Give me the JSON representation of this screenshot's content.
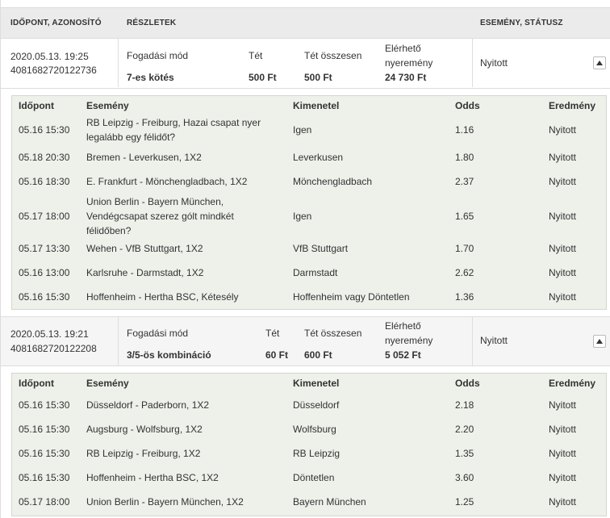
{
  "header": {
    "col_time_id": "IDŐPONT, AZONOSÍTÓ",
    "col_details": "RÉSZLETEK",
    "col_event_status": "ESEMÉNY, STÁTUSZ"
  },
  "bets": [
    {
      "datetime": "2020.05.13. 19:25",
      "id": "4081682720122736",
      "mode_label": "Fogadási mód",
      "mode_value": "7-es kötés",
      "stake_label": "Tét",
      "stake_value": "500 Ft",
      "total_label": "Tét összesen",
      "total_value": "500 Ft",
      "win_label_1": "Elérhető",
      "win_label_2": "nyeremény",
      "win_value": "24 730 Ft",
      "status": "Nyitott",
      "detail_headers": {
        "time": "Időpont",
        "event": "Esemény",
        "outcome": "Kimenetel",
        "odds": "Odds",
        "result": "Eredmény"
      },
      "rows": [
        {
          "time": "05.16 15:30",
          "event": "RB Leipzig - Freiburg, Hazai csapat nyer legalább egy félidőt?",
          "outcome": "Igen",
          "odds": "1.16",
          "result": "Nyitott"
        },
        {
          "time": "05.18 20:30",
          "event": "Bremen - Leverkusen, 1X2",
          "outcome": "Leverkusen",
          "odds": "1.80",
          "result": "Nyitott"
        },
        {
          "time": "05.16 18:30",
          "event": "E. Frankfurt - Mönchengladbach, 1X2",
          "outcome": "Mönchengladbach",
          "odds": "2.37",
          "result": "Nyitott"
        },
        {
          "time": "05.17 18:00",
          "event": "Union Berlin - Bayern München, Vendégcsapat szerez gólt mindkét félidőben?",
          "outcome": "Igen",
          "odds": "1.65",
          "result": "Nyitott"
        },
        {
          "time": "05.17 13:30",
          "event": "Wehen - VfB Stuttgart, 1X2",
          "outcome": "VfB Stuttgart",
          "odds": "1.70",
          "result": "Nyitott"
        },
        {
          "time": "05.16 13:00",
          "event": "Karlsruhe - Darmstadt, 1X2",
          "outcome": "Darmstadt",
          "odds": "2.62",
          "result": "Nyitott"
        },
        {
          "time": "05.16 15:30",
          "event": "Hoffenheim - Hertha BSC, Kétesély",
          "outcome": "Hoffenheim vagy Döntetlen",
          "odds": "1.36",
          "result": "Nyitott"
        }
      ]
    },
    {
      "datetime": "2020.05.13. 19:21",
      "id": "4081682720122208",
      "mode_label": "Fogadási mód",
      "mode_value": "3/5-ös kombináció",
      "stake_label": "Tét",
      "stake_value": "60 Ft",
      "total_label": "Tét összesen",
      "total_value": "600 Ft",
      "win_label_1": "Elérhető",
      "win_label_2": "nyeremény",
      "win_value": "5 052 Ft",
      "status": "Nyitott",
      "detail_headers": {
        "time": "Időpont",
        "event": "Esemény",
        "outcome": "Kimenetel",
        "odds": "Odds",
        "result": "Eredmény"
      },
      "rows": [
        {
          "time": "05.16 15:30",
          "event": "Düsseldorf - Paderborn, 1X2",
          "outcome": "Düsseldorf",
          "odds": "2.18",
          "result": "Nyitott"
        },
        {
          "time": "05.16 15:30",
          "event": "Augsburg - Wolfsburg, 1X2",
          "outcome": "Wolfsburg",
          "odds": "2.20",
          "result": "Nyitott"
        },
        {
          "time": "05.16 15:30",
          "event": "RB Leipzig - Freiburg, 1X2",
          "outcome": "RB Leipzig",
          "odds": "1.35",
          "result": "Nyitott"
        },
        {
          "time": "05.16 15:30",
          "event": "Hoffenheim - Hertha BSC, 1X2",
          "outcome": "Döntetlen",
          "odds": "3.60",
          "result": "Nyitott"
        },
        {
          "time": "05.17 18:00",
          "event": "Union Berlin - Bayern München, 1X2",
          "outcome": "Bayern München",
          "odds": "1.25",
          "result": "Nyitott"
        }
      ]
    }
  ],
  "icons": {
    "collapse": "chevron-up-icon"
  }
}
